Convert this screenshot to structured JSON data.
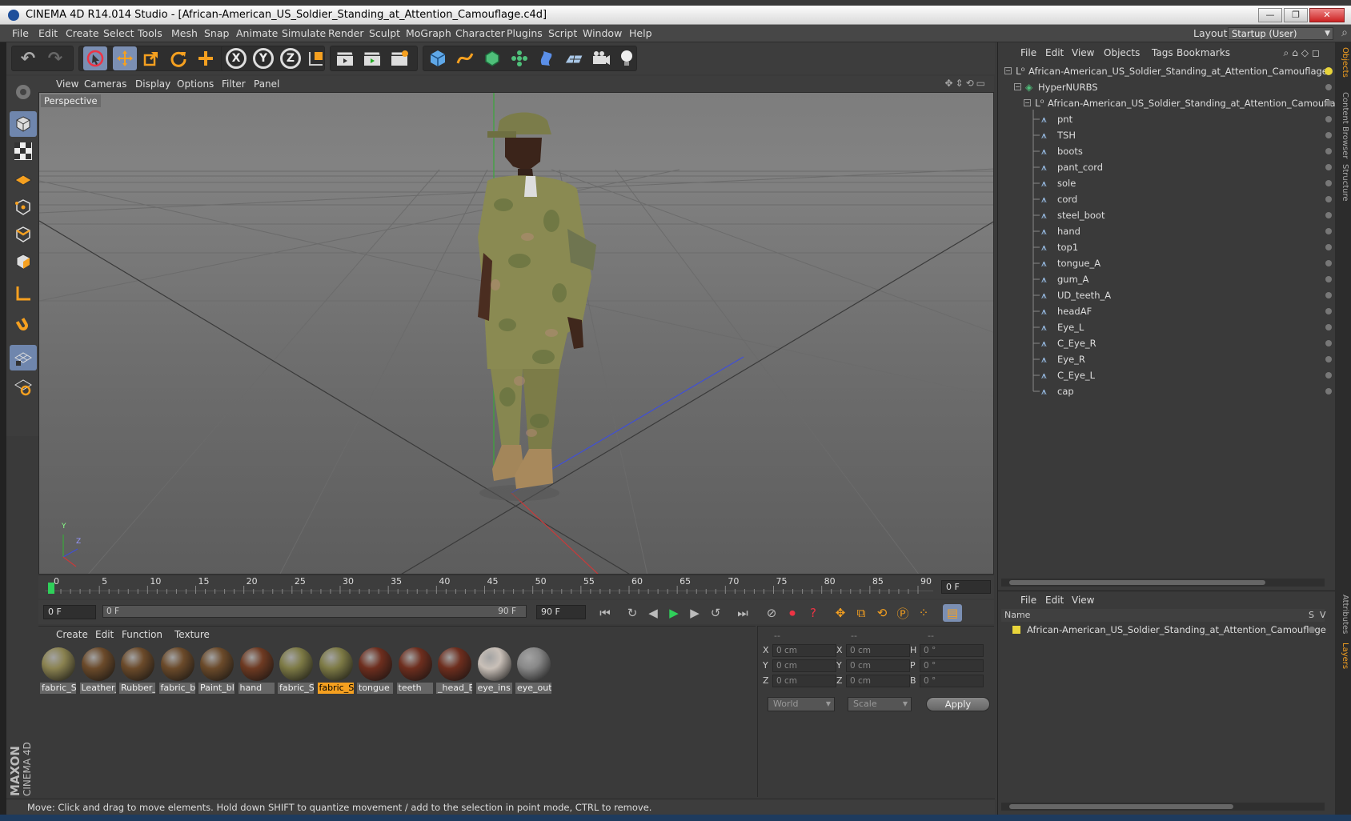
{
  "window": {
    "title": "CINEMA 4D R14.014 Studio - [African-American_US_Soldier_Standing_at_Attention_Camouflage.c4d]",
    "minimize_glyph": "—",
    "maximize_glyph": "❐",
    "close_glyph": "✕"
  },
  "menu": {
    "items": [
      "File",
      "Edit",
      "Create",
      "Select",
      "Tools",
      "Mesh",
      "Snap",
      "Animate",
      "Simulate",
      "Render",
      "Sculpt",
      "MoGraph",
      "Character",
      "Plugins",
      "Script",
      "Window",
      "Help"
    ],
    "layout_label": "Layout:",
    "layout_value": "Startup (User)"
  },
  "toolbar": {
    "undo_glyph": "↶",
    "redo_glyph": "↷",
    "axis_x": "X",
    "axis_y": "Y",
    "axis_z": "Z"
  },
  "viewport": {
    "menu": [
      "View",
      "Cameras",
      "Display",
      "Options",
      "Filter",
      "Panel"
    ],
    "label": "Perspective",
    "axis_y": "Y",
    "axis_z": "Z"
  },
  "timeline": {
    "ticks": [
      "0",
      "5",
      "10",
      "15",
      "20",
      "25",
      "30",
      "35",
      "40",
      "45",
      "50",
      "55",
      "60",
      "65",
      "70",
      "75",
      "80",
      "85",
      "90"
    ],
    "current_frame": "0 F"
  },
  "transport": {
    "start_field": "0 F",
    "range_start": "0 F",
    "range_end": "90 F",
    "end_field": "90 F"
  },
  "materials": {
    "menu": [
      "Create",
      "Edit",
      "Function",
      "Texture"
    ],
    "items": [
      {
        "label": "fabric_S",
        "color": "#8a8250",
        "selected": false
      },
      {
        "label": "Leather_",
        "color": "#6b4a2a",
        "selected": false
      },
      {
        "label": "Rubber_",
        "color": "#6b4a2a",
        "selected": false
      },
      {
        "label": "fabric_b",
        "color": "#6b4a2a",
        "selected": false
      },
      {
        "label": "Paint_bl",
        "color": "#6b4a2a",
        "selected": false
      },
      {
        "label": "hand",
        "color": "#6e3a22",
        "selected": false
      },
      {
        "label": "fabric_S",
        "color": "#7d7a45",
        "selected": false
      },
      {
        "label": "fabric_S",
        "color": "#7d7a45",
        "selected": true
      },
      {
        "label": "tongue",
        "color": "#6e2e1e",
        "selected": false
      },
      {
        "label": "teeth",
        "color": "#6e2e1e",
        "selected": false
      },
      {
        "label": "_head_E",
        "color": "#6e2e1e",
        "selected": false
      },
      {
        "label": "eye_ins",
        "color": "#c9c0b8",
        "selected": false
      },
      {
        "label": "eye_out",
        "color": "#888888",
        "selected": false
      }
    ]
  },
  "coords": {
    "headers": [
      "--",
      "--",
      "--"
    ],
    "rows": [
      {
        "l1": "X",
        "v1": "0 cm",
        "l2": "X",
        "v2": "0 cm",
        "l3": "H",
        "v3": "0 °"
      },
      {
        "l1": "Y",
        "v1": "0 cm",
        "l2": "Y",
        "v2": "0 cm",
        "l3": "P",
        "v3": "0 °"
      },
      {
        "l1": "Z",
        "v1": "0 cm",
        "l2": "Z",
        "v2": "0 cm",
        "l3": "B",
        "v3": "0 °"
      }
    ],
    "world": "World",
    "scale": "Scale",
    "apply": "Apply"
  },
  "status": {
    "text": "Move: Click and drag to move elements. Hold down SHIFT to quantize movement / add to the selection in point mode, CTRL to remove."
  },
  "brand": {
    "maxon": "MAXON",
    "cinema": "CINEMA 4D"
  },
  "objects": {
    "menu": [
      "File",
      "Edit",
      "View",
      "Objects",
      "Tags",
      "Bookmarks"
    ],
    "root": "African-American_US_Soldier_Standing_at_Attention_Camouflage",
    "hypernurbs": "HyperNURBS",
    "group": "African-American_US_Soldier_Standing_at_Attention_Camouflage",
    "children": [
      "pnt",
      "TSH",
      "boots",
      "pant_cord",
      "sole",
      "cord",
      "steel_boot",
      "hand",
      "top1",
      "tongue_A",
      "gum_A",
      "UD_teeth_A",
      "headAF",
      "Eye_L",
      "C_Eye_R",
      "Eye_R",
      "C_Eye_L",
      "cap"
    ]
  },
  "layers": {
    "menu": [
      "File",
      "Edit",
      "View"
    ],
    "col_name": "Name",
    "col_s": "S",
    "col_v": "V",
    "row": "African-American_US_Soldier_Standing_at_Attention_Camouflage"
  },
  "side_tabs": [
    "Objects",
    "Content Browser",
    "Structure",
    "Attributes",
    "Layers"
  ],
  "colors": {
    "accent": "#f5a020",
    "selection": "#7b8fb3"
  }
}
